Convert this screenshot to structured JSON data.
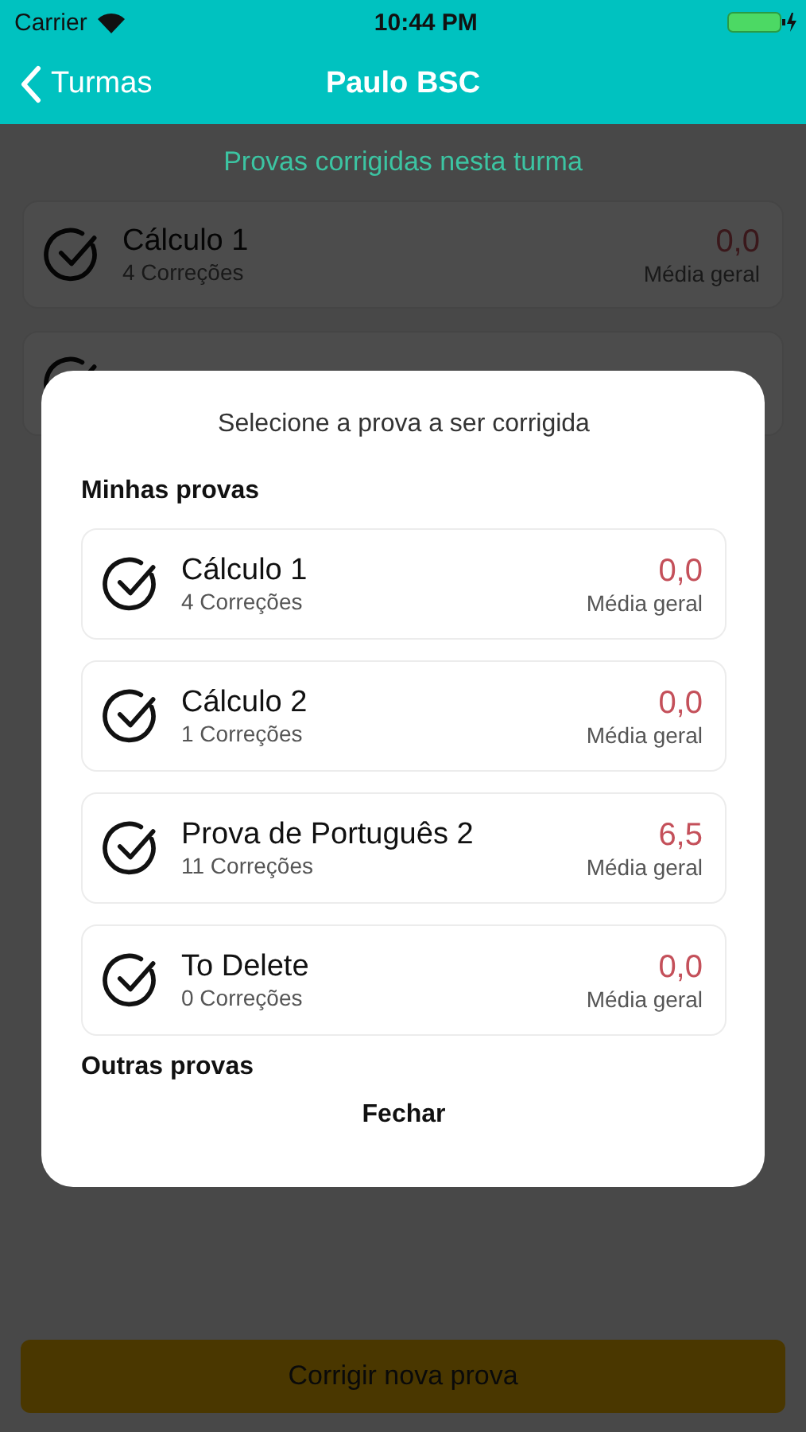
{
  "status_bar": {
    "carrier": "Carrier",
    "time": "10:44 PM"
  },
  "nav": {
    "back": "Turmas",
    "title": "Paulo BSC"
  },
  "page": {
    "heading": "Provas corrigidas nesta turma",
    "exams": [
      {
        "title": "Cálculo 1",
        "subtitle": "4 Correções",
        "score": "0,0",
        "score_label": "Média geral"
      },
      {
        "kind": "covered"
      }
    ],
    "action_button": "Corrigir nova prova"
  },
  "modal": {
    "title": "Selecione a prova a ser corrigida",
    "sections": [
      {
        "heading": "Minhas provas",
        "exams": [
          {
            "title": "Cálculo 1",
            "subtitle": "4 Correções",
            "score": "0,0",
            "score_label": "Média geral"
          },
          {
            "title": "Cálculo 2",
            "subtitle": "1 Correções",
            "score": "0,0",
            "score_label": "Média geral"
          },
          {
            "title": "Prova de Português 2",
            "subtitle": "11 Correções",
            "score": "6,5",
            "score_label": "Média geral"
          },
          {
            "title": "To Delete",
            "subtitle": "0 Correções",
            "score": "0,0",
            "score_label": "Média geral"
          }
        ]
      },
      {
        "heading": "Outras provas"
      }
    ],
    "close": "Fechar"
  }
}
